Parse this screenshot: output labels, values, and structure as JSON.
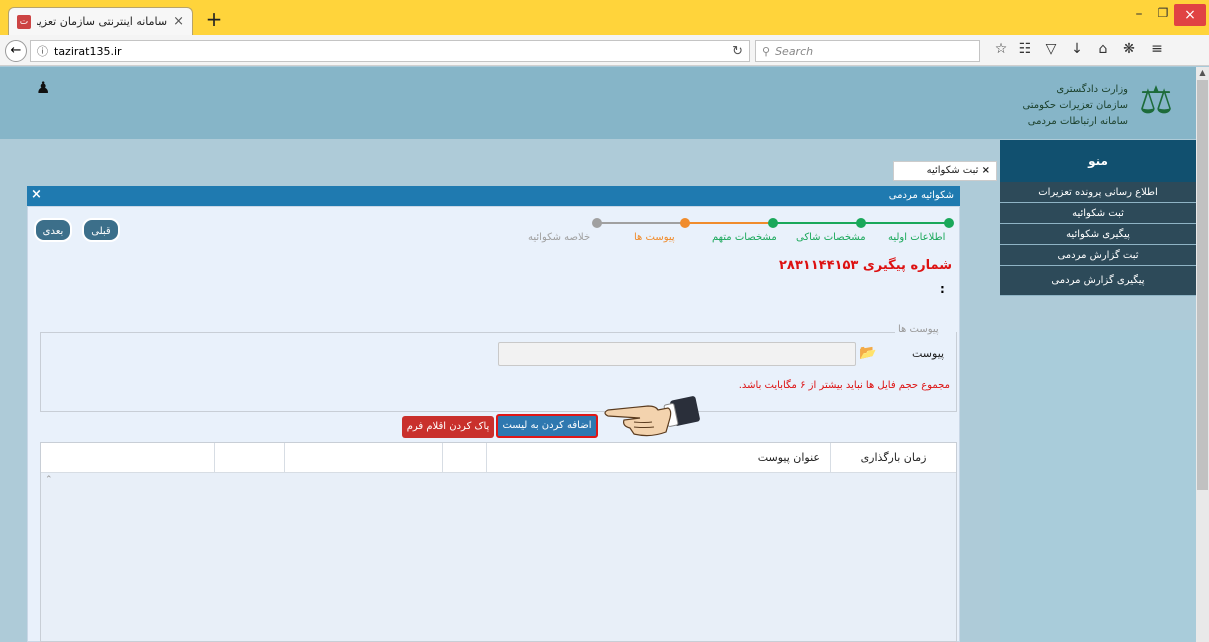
{
  "browser": {
    "tab_title": "سامانه اینترنتی سازمان تعزیرات",
    "tab_close": "×",
    "new_tab": "+",
    "url": "tazirat135.ir",
    "search_placeholder": "Search",
    "window_min": "–",
    "window_max": "❐",
    "window_close": "×"
  },
  "header": {
    "org_line1": "وزارت دادگستری",
    "org_line2": "سازمان تعزیرات حکومتی",
    "org_line3": "سامانه ارتباطات مردمی"
  },
  "sidebar": {
    "title": "منو",
    "items": [
      {
        "label": "اطلاع رسانی پرونده تعزیرات"
      },
      {
        "label": "ثبت شکوائیه"
      },
      {
        "label": "پیگیری شکوائیه"
      },
      {
        "label": "ثبت گزارش مردمی"
      },
      {
        "label": "پیگیری گزارش مردمی"
      }
    ]
  },
  "main": {
    "tab_label": "ثبت شکوائیه",
    "tab_close": "×",
    "form_title": "شکوائیه مردمی",
    "form_close": "×",
    "prev_button": "قبلی",
    "next_button": "بعدی",
    "steps": [
      {
        "label": "اطلاعات اولیه",
        "status": "done",
        "color": "#1aa85a"
      },
      {
        "label": "مشخصات شاکی",
        "status": "done",
        "color": "#1aa85a"
      },
      {
        "label": "مشخصات متهم",
        "status": "done",
        "color": "#1aa85a"
      },
      {
        "label": "پیوست ها",
        "status": "current",
        "color": "#f08c2c"
      },
      {
        "label": "خلاصه شکوائیه",
        "status": "pending",
        "color": "#a0a0a0"
      }
    ],
    "tracking_number": "شماره پیگیری ۲۸۳۱۱۴۴۱۵۳",
    "colon": ":",
    "attachments_legend": "پیوست ها",
    "attachment_label": "پیوست",
    "attachment_value": "",
    "size_note": "مجموع حجم فایل ها نباید بیشتر از ۶ مگابایت باشد.",
    "add_button": "اضافه کردن به لیست",
    "clear_button": "پاک کردن اقلام فرم",
    "table": {
      "columns": [
        "زمان بارگذاری",
        "عنوان پیوست",
        "",
        "",
        ""
      ],
      "rows": []
    }
  }
}
